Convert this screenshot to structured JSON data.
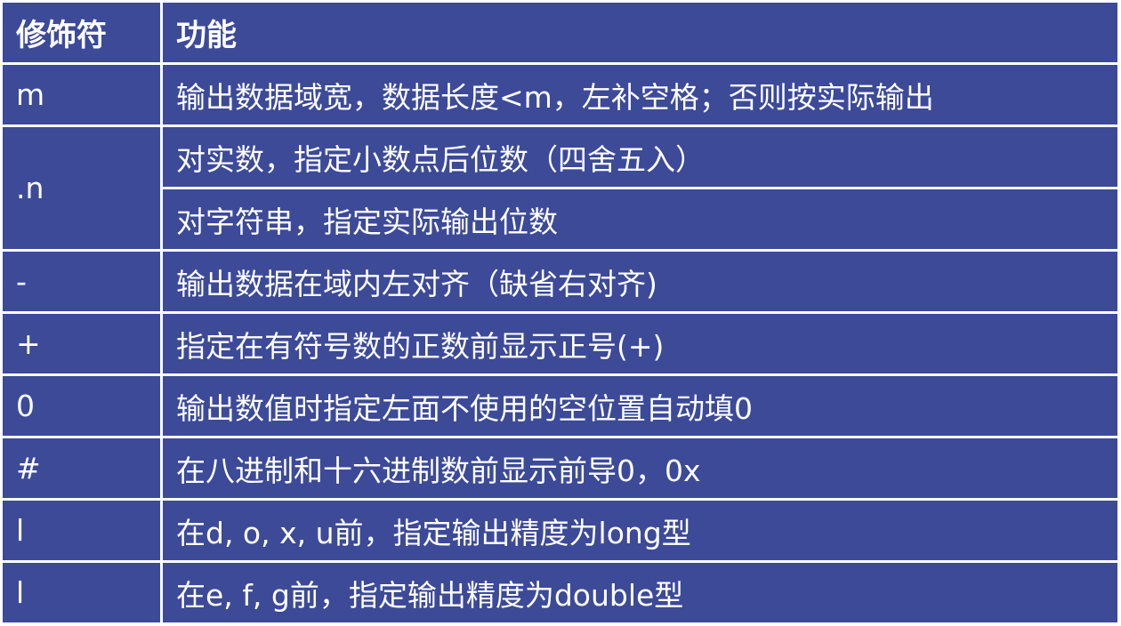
{
  "header": {
    "modifier": "修饰符",
    "function": "功能"
  },
  "rows": [
    {
      "modifier": "m",
      "function": "输出数据域宽，数据长度<m，左补空格；否则按实际输出"
    },
    {
      "modifier": ".n",
      "function": "对实数，指定小数点后位数（四舍五入）"
    },
    {
      "modifier": "",
      "function": "对字符串，指定实际输出位数"
    },
    {
      "modifier": "-",
      "function": "输出数据在域内左对齐（缺省右对齐)"
    },
    {
      "modifier": "+",
      "function": "指定在有符号数的正数前显示正号(+)"
    },
    {
      "modifier": "0",
      "function": "输出数值时指定左面不使用的空位置自动填0"
    },
    {
      "modifier": "#",
      "function": "在八进制和十六进制数前显示前导0，0x"
    },
    {
      "modifier": "l",
      "function": "在d, o, x, u前，指定输出精度为long型"
    },
    {
      "modifier": "l",
      "function": "在e, f, g前，指定输出精度为double型"
    }
  ]
}
